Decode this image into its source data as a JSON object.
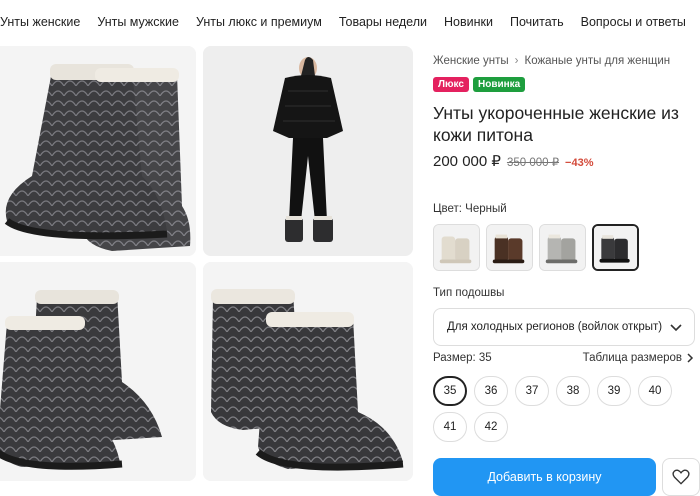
{
  "nav": [
    "Унты женские",
    "Унты мужские",
    "Унты люкс и премиум",
    "Товары недели",
    "Новинки",
    "Почитать",
    "Вопросы и ответы"
  ],
  "breadcrumbs": [
    "Женские унты",
    "Кожаные унты для женщин"
  ],
  "breadcrumb_sep": "›",
  "badges": {
    "lux": "Люкс",
    "new": "Новинка"
  },
  "product": {
    "title": "Унты укороченные женские из кожи питона",
    "price": "200 000 ₽",
    "old_price": "350 000 ₽",
    "discount": "−43%"
  },
  "color": {
    "label": "Цвет: Черный",
    "options": [
      "white-boot",
      "brown-boot",
      "grey-boot",
      "black-boot"
    ],
    "selected_index": 3
  },
  "sole": {
    "label": "Тип подошвы",
    "value": "Для холодных регионов (войлок открыт)"
  },
  "size": {
    "label": "Размер: 35",
    "table_link": "Таблица размеров",
    "options": [
      "35",
      "36",
      "37",
      "38",
      "39",
      "40",
      "41",
      "42"
    ],
    "selected": "35"
  },
  "actions": {
    "add_to_cart": "Добавить в корзину"
  },
  "colors": {
    "accent": "#2196f3",
    "lux": "#e4215f",
    "new": "#1e9e3e",
    "discount": "#d34a3a"
  }
}
